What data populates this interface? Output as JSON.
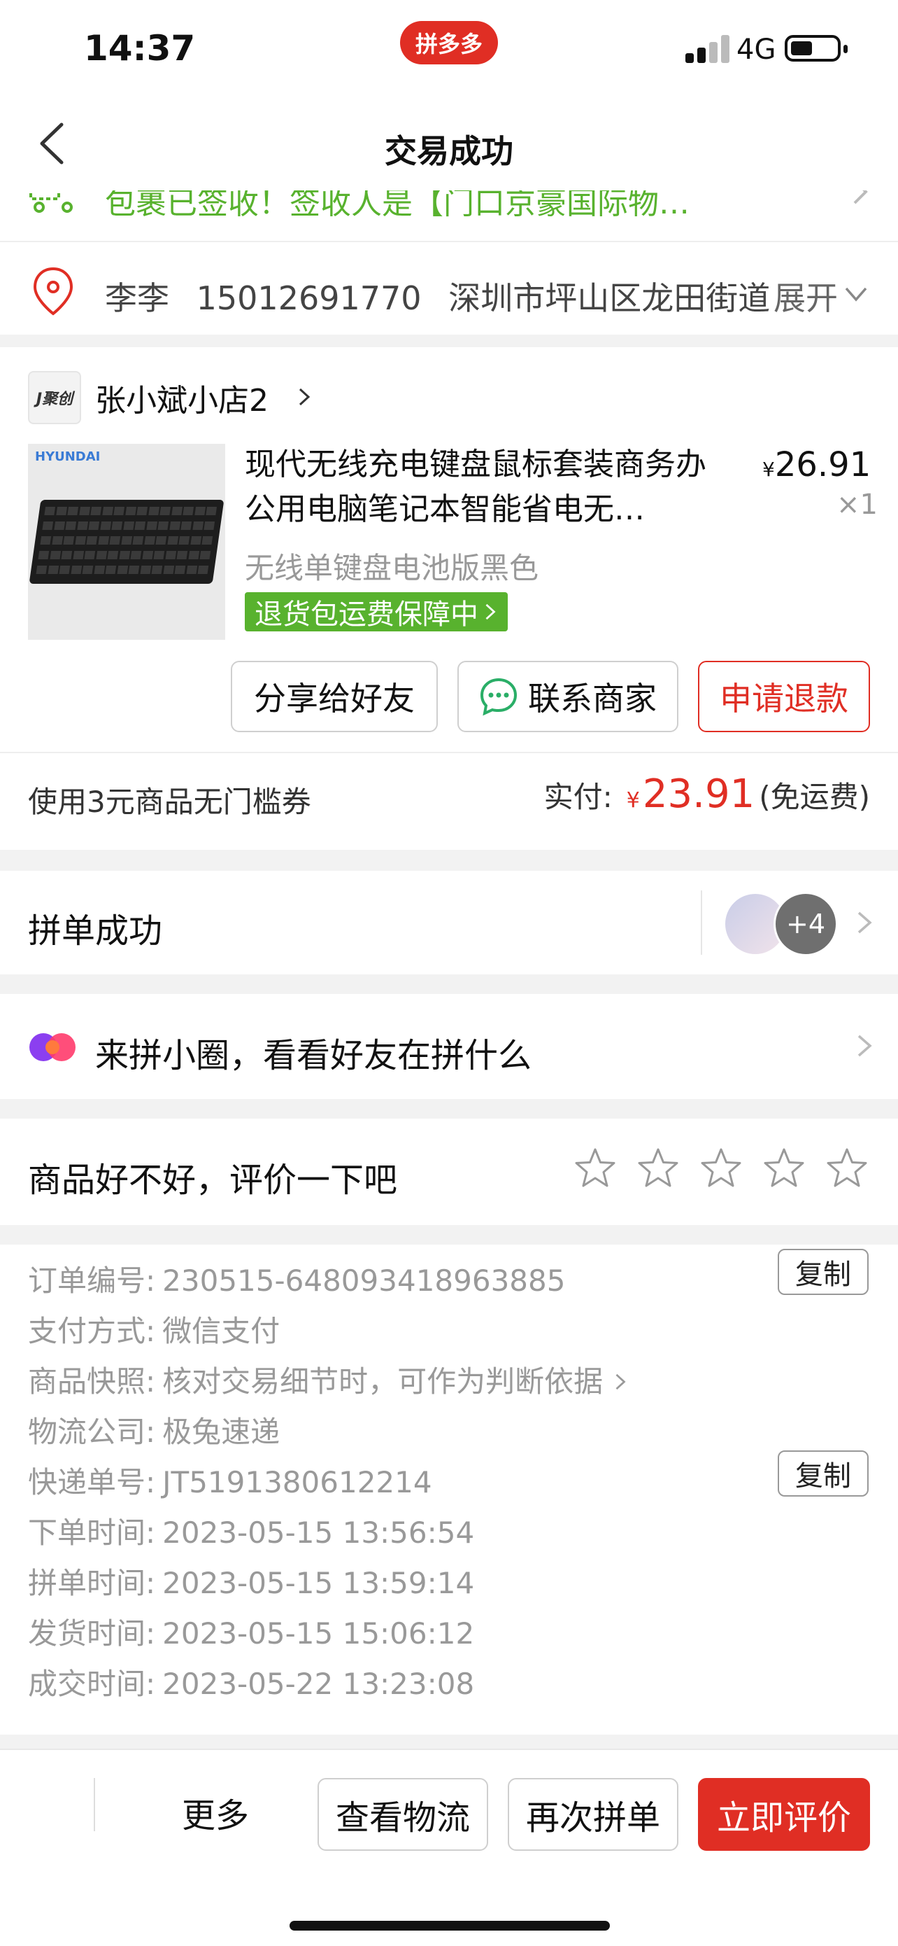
{
  "status_bar": {
    "time": "14:37",
    "app_badge": "拼多多",
    "network": "4G"
  },
  "nav": {
    "title": "交易成功"
  },
  "logistics": {
    "text": "包裹已签收！签收人是【门口京豪国际物…"
  },
  "address": {
    "name": "李李",
    "phone": "15012691770",
    "address": "深圳市坪山区龙田街道",
    "expand_label": "展开"
  },
  "shop": {
    "logo_text": "J聚创",
    "name": "张小斌小店2",
    "product": {
      "brand_tag": "HYUNDAI",
      "title": "现代无线充电键盘鼠标套装商务办公用电脑笔记本智能省电无…",
      "price_symbol": "¥",
      "price": "26.91",
      "quantity": "×1",
      "spec": "无线单键盘电池版黑色",
      "guarantee": "退货包运费保障中"
    },
    "actions": {
      "share": "分享给好友",
      "contact": "联系商家",
      "refund": "申请退款"
    },
    "coupon": "使用3元商品无门槛券",
    "paid_label": "实付:",
    "paid_symbol": "¥",
    "paid_amount": "23.91",
    "shipping_note": "(免运费)"
  },
  "group": {
    "label": "拼单成功",
    "more_count": "+4"
  },
  "circle": {
    "label": "来拼小圈，看看好友在拼什么"
  },
  "rate": {
    "label": "商品好不好，评价一下吧",
    "stars": 5,
    "filled": 0
  },
  "order_info": {
    "rows": [
      {
        "key": "订单编号:",
        "value": "230515-648093418963885",
        "copy": "复制"
      },
      {
        "key": "支付方式:",
        "value": "微信支付"
      },
      {
        "key": "商品快照:",
        "value": "核对交易细节时，可作为判断依据"
      },
      {
        "key": "物流公司:",
        "value": "极兔速递"
      },
      {
        "key": "快递单号:",
        "value": "JT5191380612214",
        "copy": "复制"
      },
      {
        "key": "下单时间:",
        "value": "2023-05-15 13:56:54"
      },
      {
        "key": "拼单时间:",
        "value": "2023-05-15 13:59:14"
      },
      {
        "key": "发货时间:",
        "value": "2023-05-15 15:06:12"
      },
      {
        "key": "成交时间:",
        "value": "2023-05-22 13:23:08"
      }
    ]
  },
  "bottom_bar": {
    "more": "更多",
    "view_logistics": "查看物流",
    "rebuy": "再次拼单",
    "review": "立即评价"
  },
  "colors": {
    "accent_red": "#e02e24",
    "green": "#58b22e"
  }
}
